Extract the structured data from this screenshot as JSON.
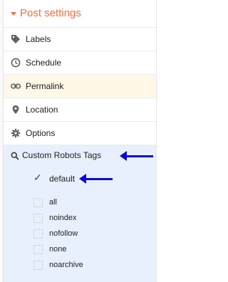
{
  "header": {
    "title": "Post settings",
    "color": "#f36c3d"
  },
  "menu": {
    "items": [
      {
        "label": "Labels",
        "icon": "label-icon"
      },
      {
        "label": "Schedule",
        "icon": "clock-icon"
      },
      {
        "label": "Permalink",
        "icon": "link-icon",
        "active": true
      },
      {
        "label": "Location",
        "icon": "location-pin-icon"
      },
      {
        "label": "Options",
        "icon": "gear-icon"
      }
    ]
  },
  "robots": {
    "title": "Custom Robots Tags",
    "icon": "search-icon",
    "options": [
      {
        "label": "default",
        "checked": true
      },
      {
        "label": "all",
        "checked": false
      },
      {
        "label": "noindex",
        "checked": false
      },
      {
        "label": "nofollow",
        "checked": false
      },
      {
        "label": "none",
        "checked": false
      },
      {
        "label": "noarchive",
        "checked": false
      }
    ]
  },
  "colors": {
    "accent": "#f36c3d",
    "expanded_bg": "#e8f0fe",
    "active_bg": "#fff7e8",
    "annotation_arrow": "#0b0bd6"
  }
}
